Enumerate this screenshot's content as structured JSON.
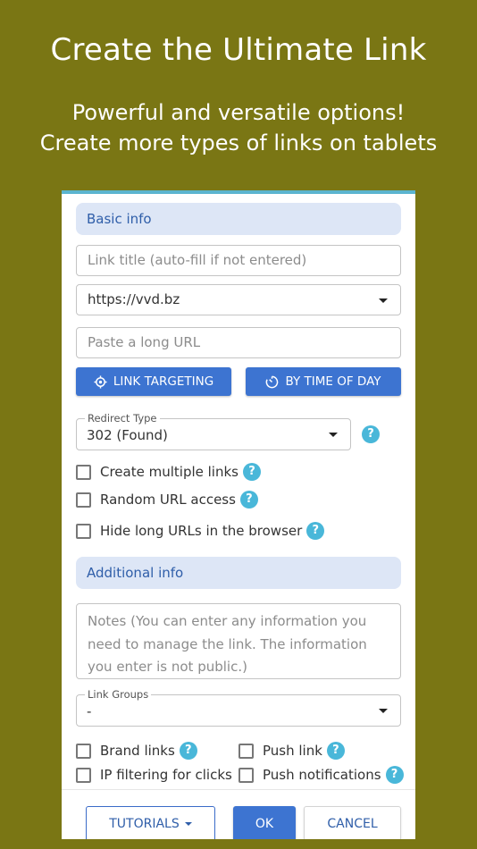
{
  "promo": {
    "headline": "Create the Ultimate Link",
    "sub_line1": "Powerful and versatile options!",
    "sub_line2": "Create more types of links on tablets"
  },
  "basic_info": {
    "section_label": "Basic info",
    "link_title_placeholder": "Link title (auto-fill if not entered)",
    "domain_value": "https://vvd.bz",
    "long_url_placeholder": "Paste a long URL",
    "link_targeting_label": "LINK TARGETING",
    "by_time_of_day_label": "BY TIME OF DAY",
    "redirect_type_legend": "Redirect Type",
    "redirect_type_value": "302 (Found)",
    "options": [
      {
        "label": "Create multiple links",
        "checked": false
      },
      {
        "label": "Random URL access",
        "checked": false
      },
      {
        "label": "Hide long URLs in the browser",
        "checked": false
      }
    ]
  },
  "additional_info": {
    "section_label": "Additional info",
    "notes_placeholder": "Notes (You can enter any information you need to manage the link. The information you enter is not public.)",
    "link_groups_legend": "Link Groups",
    "link_groups_value": "-",
    "options": [
      {
        "label": "Brand links",
        "checked": false
      },
      {
        "label": "Push link",
        "checked": false
      },
      {
        "label": "IP filtering for clicks",
        "checked": false
      },
      {
        "label": "Push notifications",
        "checked": false
      }
    ]
  },
  "footer": {
    "tutorials_label": "TUTORIALS",
    "ok_label": "OK",
    "cancel_label": "CANCEL"
  },
  "help_glyph": "?",
  "colors": {
    "background": "#7a7614",
    "primary": "#3d74d1",
    "section_bg": "#dde6f6",
    "help": "#49b7d9",
    "card_top_border": "#5bb4cf"
  }
}
